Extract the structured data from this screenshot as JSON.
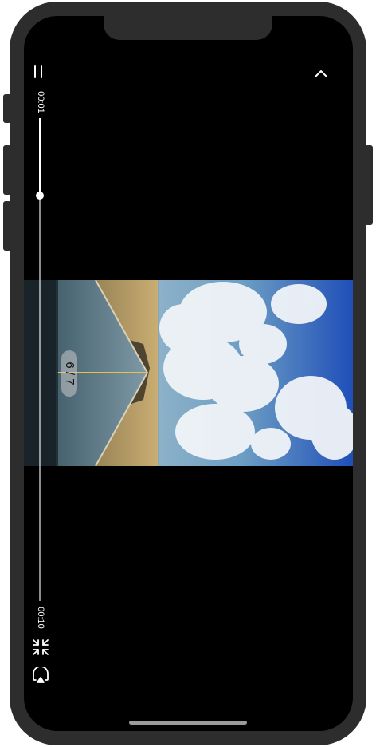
{
  "player": {
    "time_current": "00:01",
    "time_total": "00:10",
    "progress_fraction": 0.16,
    "slide_counter": "6 / 7"
  },
  "icons": {
    "menu": "menu-icon",
    "close": "chevron-up-icon",
    "collapse": "collapse-icon",
    "airplay": "airplay-icon"
  },
  "colors": {
    "screen_bg": "#000000",
    "device_frame": "#2d2d2d",
    "control": "#ffffff"
  }
}
